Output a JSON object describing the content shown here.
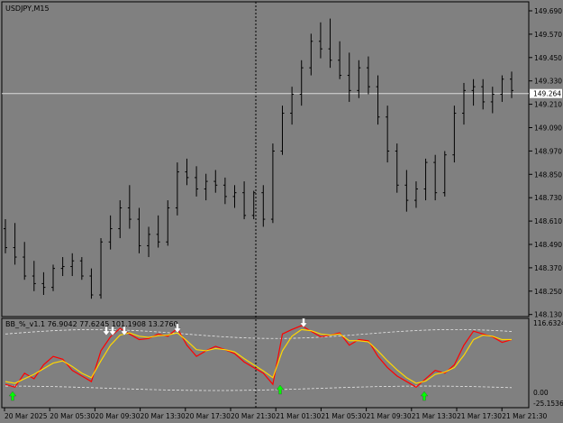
{
  "window": {
    "symbol_title": "USDJPY,M15"
  },
  "price_axis": {
    "labels": [
      "149.690",
      "149.570",
      "149.450",
      "149.330",
      "149.210",
      "149.090",
      "148.970",
      "148.850",
      "148.730",
      "148.610",
      "148.490",
      "148.370",
      "148.250",
      "148.130"
    ],
    "current_price": "149.264"
  },
  "indicator": {
    "title": "BB_%_v1.1 76.9042 77.6245 101.1908 13.2760",
    "axis_top": "116.6324",
    "axis_zero": "0.00",
    "axis_bottom": "-25.1536"
  },
  "time_axis": {
    "labels": [
      "20 Mar 2025",
      "20 Mar 05:30",
      "20 Mar 09:30",
      "20 Mar 13:30",
      "20 Mar 17:30",
      "20 Mar 21:30",
      "21 Mar 01:30",
      "21 Mar 05:30",
      "21 Mar 09:30",
      "21 Mar 13:30",
      "21 Mar 17:30",
      "21 Mar 21:30"
    ]
  },
  "colors": {
    "background": "#808080",
    "bars": "#000000",
    "price_line": "#d9d9d9",
    "oscillator_fast": "#ff0000",
    "oscillator_slow": "#ffd700",
    "bands": "#e6e6e6",
    "arrow_up": "#00ff00",
    "arrow_down": "#ffffff"
  },
  "chart_data": [
    {
      "type": "ohlc",
      "series_ohlc": [
        [
          148.55,
          148.6,
          148.42,
          148.45
        ],
        [
          148.45,
          148.58,
          148.36,
          148.4
        ],
        [
          148.4,
          148.48,
          148.28,
          148.3
        ],
        [
          148.3,
          148.38,
          148.22,
          148.26
        ],
        [
          148.26,
          148.32,
          148.2,
          148.24
        ],
        [
          148.24,
          148.36,
          148.22,
          148.34
        ],
        [
          148.34,
          148.4,
          148.3,
          148.35
        ],
        [
          148.35,
          148.42,
          148.3,
          148.38
        ],
        [
          148.38,
          148.4,
          148.28,
          148.3
        ],
        [
          148.3,
          148.34,
          148.18,
          148.2
        ],
        [
          148.2,
          148.5,
          148.18,
          148.48
        ],
        [
          148.48,
          148.62,
          148.44,
          148.55
        ],
        [
          148.55,
          148.7,
          148.5,
          148.66
        ],
        [
          148.66,
          148.78,
          148.55,
          148.6
        ],
        [
          148.6,
          148.66,
          148.42,
          148.46
        ],
        [
          148.46,
          148.56,
          148.4,
          148.52
        ],
        [
          148.52,
          148.62,
          148.45,
          148.48
        ],
        [
          148.48,
          148.7,
          148.46,
          148.66
        ],
        [
          148.66,
          148.9,
          148.62,
          148.85
        ],
        [
          148.85,
          148.92,
          148.78,
          148.82
        ],
        [
          148.82,
          148.88,
          148.72,
          148.76
        ],
        [
          148.76,
          148.84,
          148.7,
          148.8
        ],
        [
          148.8,
          148.86,
          148.74,
          148.78
        ],
        [
          148.78,
          148.82,
          148.68,
          148.72
        ],
        [
          148.72,
          148.78,
          148.66,
          148.74
        ],
        [
          148.74,
          148.8,
          148.6,
          148.62
        ],
        [
          148.62,
          148.75,
          148.6,
          148.74
        ],
        [
          148.74,
          148.78,
          148.56,
          148.6
        ],
        [
          148.6,
          149.0,
          148.58,
          148.96
        ],
        [
          148.96,
          149.2,
          148.94,
          149.16
        ],
        [
          149.16,
          149.3,
          149.1,
          149.26
        ],
        [
          149.26,
          149.44,
          149.2,
          149.4
        ],
        [
          149.4,
          149.58,
          149.36,
          149.54
        ],
        [
          149.54,
          149.64,
          149.45,
          149.5
        ],
        [
          149.5,
          149.66,
          149.4,
          149.44
        ],
        [
          149.44,
          149.54,
          149.34,
          149.36
        ],
        [
          149.36,
          149.48,
          149.22,
          149.28
        ],
        [
          149.28,
          149.44,
          149.24,
          149.4
        ],
        [
          149.4,
          149.46,
          149.26,
          149.3
        ],
        [
          149.3,
          149.36,
          149.1,
          149.14
        ],
        [
          149.14,
          149.2,
          148.9,
          148.96
        ],
        [
          148.96,
          149.0,
          148.74,
          148.78
        ],
        [
          148.78,
          148.86,
          148.64,
          148.7
        ],
        [
          148.7,
          148.8,
          148.66,
          148.76
        ],
        [
          148.76,
          148.92,
          148.7,
          148.9
        ],
        [
          148.9,
          148.94,
          148.7,
          148.74
        ],
        [
          148.74,
          148.96,
          148.72,
          148.94
        ],
        [
          148.94,
          149.2,
          148.9,
          149.16
        ],
        [
          149.16,
          149.32,
          149.1,
          149.28
        ],
        [
          149.28,
          149.34,
          149.2,
          149.3
        ],
        [
          149.3,
          149.34,
          149.18,
          149.22
        ],
        [
          149.22,
          149.3,
          149.16,
          149.26
        ],
        [
          149.26,
          149.36,
          149.22,
          149.34
        ],
        [
          149.34,
          149.38,
          149.24,
          149.28
        ]
      ],
      "ylim": [
        148.1,
        149.72
      ],
      "current_price": 149.264
    },
    {
      "type": "line",
      "title": "BB_%_v1.1 76.9042 77.6245 101.1908 13.2760",
      "series": [
        {
          "values": [
            10,
            5,
            30,
            20,
            45,
            60,
            55,
            35,
            25,
            15,
            70,
            95,
            110,
            100,
            90,
            92,
            100,
            96,
            110,
            80,
            60,
            70,
            78,
            72,
            65,
            50,
            40,
            30,
            10,
            100,
            108,
            115,
            105,
            95,
            98,
            102,
            80,
            90,
            88,
            60,
            40,
            25,
            15,
            5,
            20,
            35,
            30,
            45,
            80,
            105,
            100,
            95,
            85,
            90
          ]
        },
        {
          "values": [
            15,
            12,
            20,
            28,
            38,
            48,
            52,
            42,
            30,
            22,
            52,
            80,
            98,
            102,
            96,
            94,
            97,
            98,
            102,
            88,
            72,
            70,
            74,
            72,
            68,
            56,
            45,
            34,
            22,
            70,
            96,
            108,
            106,
            100,
            98,
            100,
            88,
            88,
            86,
            70,
            52,
            36,
            22,
            12,
            16,
            28,
            32,
            40,
            62,
            90,
            98,
            96,
            90,
            90
          ]
        }
      ],
      "ylim": [
        -25.1536,
        116.6324
      ]
    }
  ]
}
